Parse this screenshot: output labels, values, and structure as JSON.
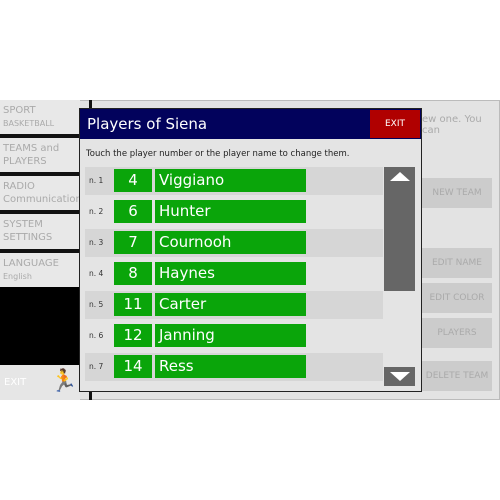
{
  "sidebar": {
    "items": [
      {
        "label": "SPORT",
        "sub": "BASKETBALL"
      },
      {
        "label": "TEAMS and",
        "sub": "PLAYERS"
      },
      {
        "label": "RADIO",
        "sub": "Communication"
      },
      {
        "label": "SYSTEM",
        "sub": "SETTINGS"
      },
      {
        "label": "LANGUAGE",
        "sub": "English"
      }
    ],
    "exit": "EXIT",
    "exit_icon": "running-man-exit-icon"
  },
  "background": {
    "text": "ew one. You can",
    "buttons": [
      "NEW TEAM",
      "EDIT NAME",
      "EDIT COLOR",
      "PLAYERS",
      "DELETE TEAM"
    ]
  },
  "dialog": {
    "title": "Players of Siena",
    "exit": "EXIT",
    "instruction": "Touch the player number or the player name to change them.",
    "players": [
      {
        "slot": "n. 1",
        "number": "4",
        "name": "Viggiano"
      },
      {
        "slot": "n. 2",
        "number": "6",
        "name": "Hunter"
      },
      {
        "slot": "n. 3",
        "number": "7",
        "name": "Cournooh"
      },
      {
        "slot": "n. 4",
        "number": "8",
        "name": "Haynes"
      },
      {
        "slot": "n. 5",
        "number": "11",
        "name": "Carter"
      },
      {
        "slot": "n. 6",
        "number": "12",
        "name": "Janning"
      },
      {
        "slot": "n. 7",
        "number": "14",
        "name": "Ress"
      }
    ]
  },
  "colors": {
    "header": "#02025c",
    "exit": "#b00000",
    "player": "#0aa50a",
    "scrollbar": "#666666"
  }
}
